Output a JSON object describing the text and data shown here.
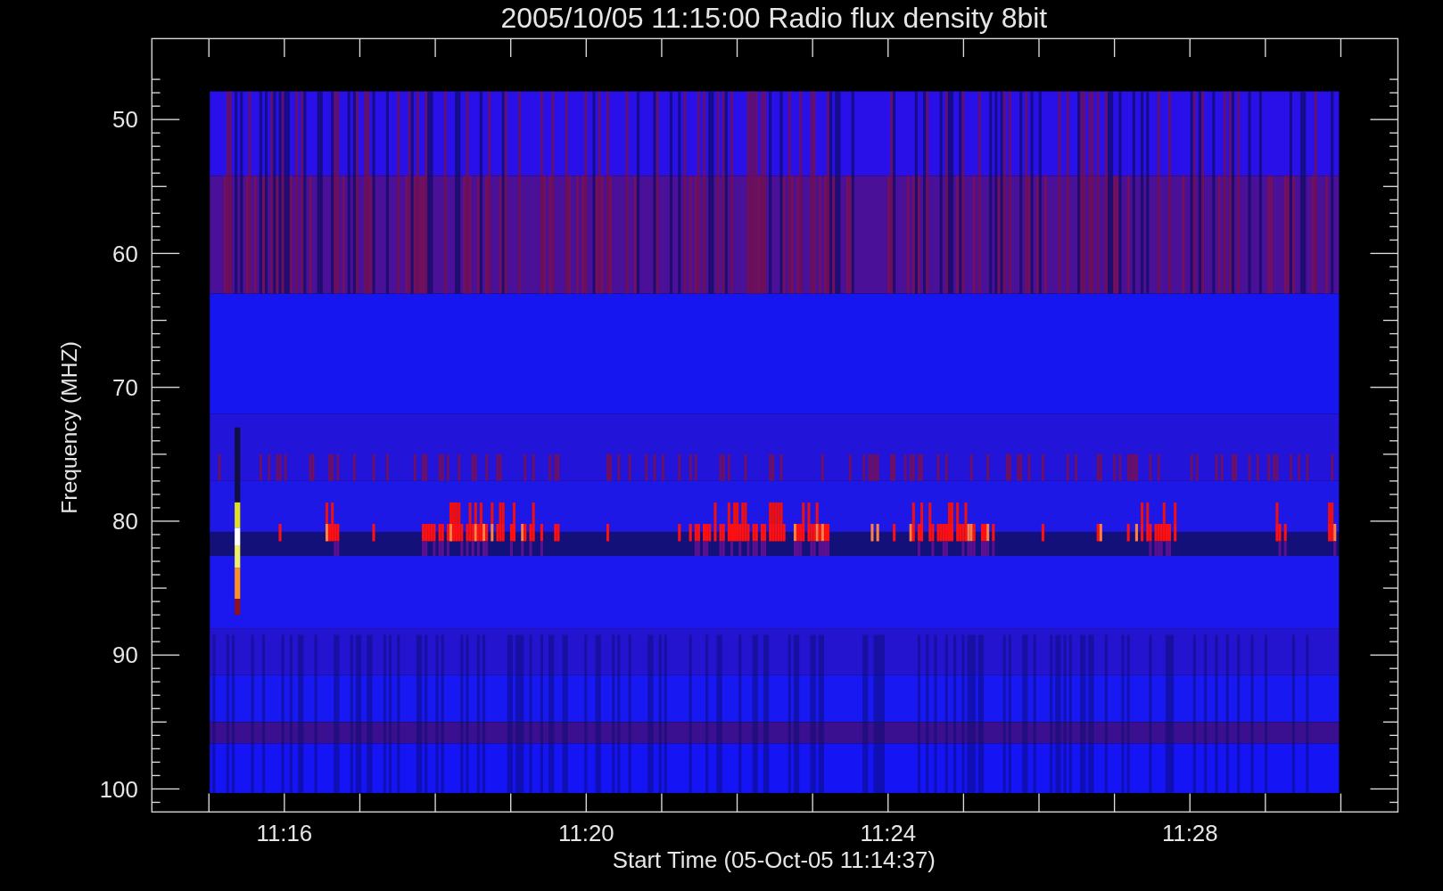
{
  "title": "2005/10/05 11:15:00 Radio flux density 8bit",
  "ylabel": "Frequency (MHZ)",
  "xlabel": "Start Time (05-Oct-05 11:14:37)",
  "yticks": [
    "50",
    "60",
    "70",
    "80",
    "90",
    "100"
  ],
  "xticks": [
    "11:16",
    "11:20",
    "11:24",
    "11:28"
  ]
}
